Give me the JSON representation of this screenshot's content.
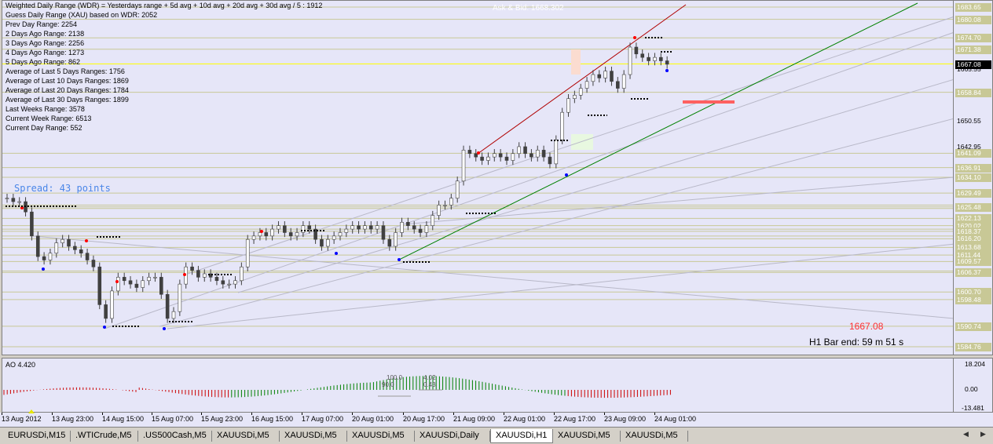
{
  "info": {
    "lines": [
      "Weighted Daily Range (WDR) = Yesterdays range + 5d avg + 10d avg + 20d avg + 30d avg / 5 : 1912",
      "Guess Daily Range (XAU) based on WDR: 2052",
      "Prev Day Range: 2254",
      "2 Days Ago Range: 2138",
      "3 Days Ago Range: 2256",
      "4 Days Ago Range: 1273",
      "5 Days Ago Range: 862",
      "Average of Last 5 Days Ranges: 1756",
      "Average of Last 10 Days Ranges: 1869",
      "Average of Last 20 Days Ranges: 1784",
      "Average of Last 30 Days Ranges: 1899",
      "Last Weeks Range: 3578",
      "Current Week Range: 6513",
      "Current Day Range: 552"
    ],
    "spread": "Spread: 43 points",
    "ask_bid": "Ask & Bid: 1668.302",
    "current_price_red": "1667.08",
    "bar_end": "H1 Bar end: 59 m 51 s"
  },
  "price_scale": {
    "labels": [
      "1683.65",
      "1680.08",
      "1674.70",
      "1671.38",
      "1665.55",
      "1658.84",
      "1650.55",
      "1642.95",
      "1641.09",
      "1636.91",
      "1634.10",
      "1629.49",
      "1625.48",
      "1622.13",
      "1620.02",
      "1618.37",
      "1616.20",
      "1613.68",
      "1611.44",
      "1609.57",
      "1606.37",
      "1600.70",
      "1598.48",
      "1590.74",
      "1584.76"
    ],
    "highlighted": [
      "1683.65",
      "1680.08",
      "1674.70",
      "1671.38",
      "1658.84",
      "1641.09",
      "1636.91",
      "1634.10",
      "1629.49",
      "1625.48",
      "1622.13",
      "1620.02",
      "1618.37",
      "1616.20",
      "1613.68",
      "1611.44",
      "1609.57",
      "1606.37",
      "1600.70",
      "1598.48",
      "1590.74",
      "1584.76"
    ],
    "current": "1667.08"
  },
  "ao": {
    "title": "AO 4.420",
    "scale_top": "18.204",
    "scale_mid": "0.00",
    "scale_bottom": "-13.481",
    "labels": [
      "100.0",
      "90.0",
      "4.02",
      "0.43"
    ]
  },
  "time_axis": [
    "13 Aug 2012",
    "13 Aug 23:00",
    "14 Aug 15:00",
    "15 Aug 07:00",
    "15 Aug 23:00",
    "16 Aug 15:00",
    "17 Aug 07:00",
    "20 Aug 01:00",
    "20 Aug 17:00",
    "21 Aug 09:00",
    "22 Aug 01:00",
    "22 Aug 17:00",
    "23 Aug 09:00",
    "24 Aug 01:00"
  ],
  "tabs": [
    {
      "label": "EURUSDi,M15",
      "active": false
    },
    {
      "label": ".WTICrude,M5",
      "active": false
    },
    {
      "label": ".US500Cash,M5",
      "active": false
    },
    {
      "label": "XAUUSDi,M5",
      "active": false
    },
    {
      "label": "XAUUSDi,M5",
      "active": false
    },
    {
      "label": "XAUUSDi,M5",
      "active": false
    },
    {
      "label": "XAUUSDi,Daily",
      "active": false
    },
    {
      "label": "XAUUSDi,H1",
      "active": true
    },
    {
      "label": "XAUUSDi,M5",
      "active": false
    },
    {
      "label": "XAUUSDi,M5",
      "active": false
    }
  ],
  "colors": {
    "background": "#e6e6f8",
    "bull": "#008000",
    "bear": "#cc0000",
    "level_line": "#c8c896",
    "current_line": "#ffff00"
  },
  "icons": [
    "chevron-left-icon",
    "chevron-right-icon"
  ]
}
